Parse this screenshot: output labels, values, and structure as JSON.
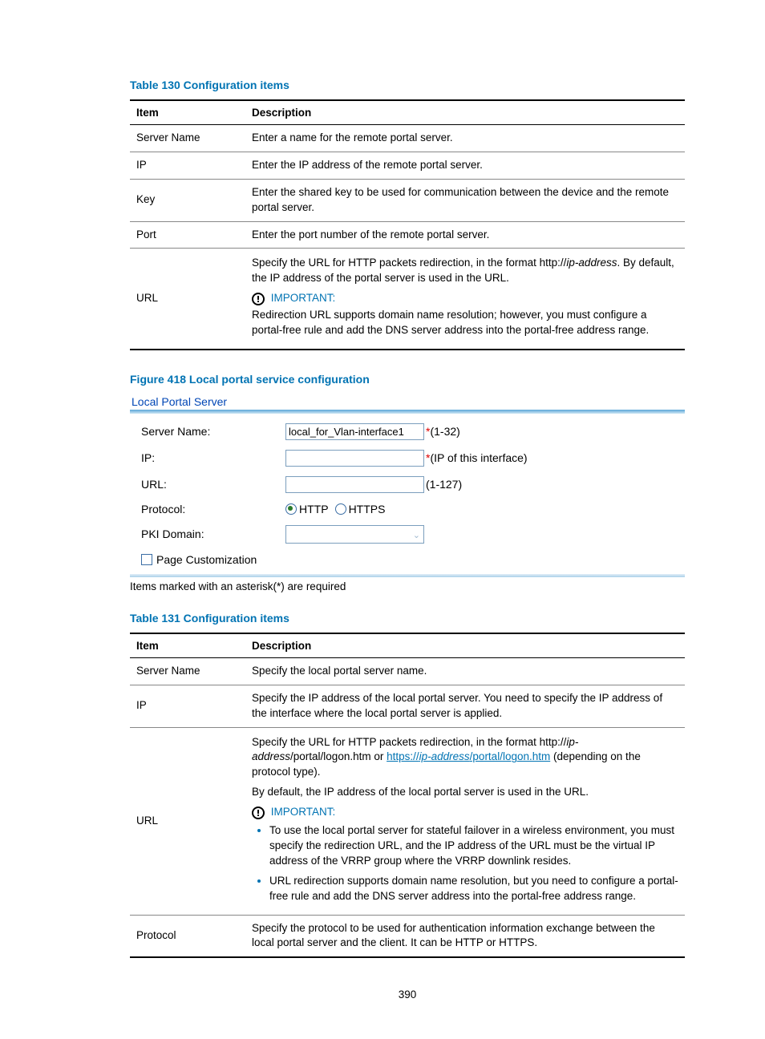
{
  "table130": {
    "title": "Table 130 Configuration items",
    "headers": {
      "item": "Item",
      "desc": "Description"
    },
    "rows": {
      "server_name": {
        "item": "Server Name",
        "desc": "Enter a name for the remote portal server."
      },
      "ip": {
        "item": "IP",
        "desc": "Enter the IP address of the remote portal server."
      },
      "key": {
        "item": "Key",
        "desc": "Enter the shared key to be used for communication between the device and the remote portal server."
      },
      "port": {
        "item": "Port",
        "desc": "Enter the port number of the remote portal server."
      },
      "url": {
        "item": "URL",
        "desc1a": "Specify the URL for HTTP packets redirection, in the format http://",
        "desc1_italic": "ip-address",
        "desc1b": ". By default, the IP address of the portal server is used in the URL.",
        "important": "IMPORTANT:",
        "desc2": "Redirection URL supports domain name resolution; however, you must configure a portal-free rule and add the DNS server address into the portal-free address range."
      }
    }
  },
  "figure418": {
    "title": "Figure 418 Local portal service configuration",
    "panel_title": "Local Portal Server",
    "rows": {
      "server_name": {
        "label": "Server Name:",
        "value": "local_for_Vlan-interface1",
        "hint": "(1-32)"
      },
      "ip": {
        "label": "IP:",
        "value": "",
        "hint": "(IP of this interface)"
      },
      "url": {
        "label": "URL:",
        "value": "",
        "hint": "(1-127)"
      },
      "protocol": {
        "label": "Protocol:",
        "opt1": "HTTP",
        "opt2": "HTTPS"
      },
      "pki": {
        "label": "PKI Domain:"
      },
      "pagecust": {
        "label": "Page Customization"
      }
    },
    "footnote": "Items marked with an asterisk(*) are required"
  },
  "table131": {
    "title": "Table 131 Configuration items",
    "headers": {
      "item": "Item",
      "desc": "Description"
    },
    "rows": {
      "server_name": {
        "item": "Server Name",
        "desc": "Specify the local portal server name."
      },
      "ip": {
        "item": "IP",
        "desc": "Specify the IP address of the local portal server. You need to specify the IP address of the interface where the local portal server is applied."
      },
      "url": {
        "item": "URL",
        "p1a": "Specify the URL for HTTP packets redirection, in the format http://",
        "p1_it1": "ip-address",
        "p1b": "/portal/logon.htm or ",
        "link_a": "https://",
        "link_it": "ip-address",
        "link_b": "/portal/logon.htm",
        "p1c": " (depending on the protocol type).",
        "p2": "By default, the IP address of the local portal server is used in the URL.",
        "important": "IMPORTANT:",
        "b1": "To use the local portal server for stateful failover in a wireless environment, you must specify the redirection URL, and the IP address of the URL must be the virtual IP address of the VRRP group where the VRRP downlink resides.",
        "b2": "URL redirection supports domain name resolution, but you need to configure a portal-free rule and add the DNS server address into the portal-free address range."
      },
      "protocol": {
        "item": "Protocol",
        "desc": "Specify the protocol to be used for authentication information exchange between the local portal server and the client. It can be HTTP or HTTPS."
      }
    }
  },
  "page_num": "390"
}
